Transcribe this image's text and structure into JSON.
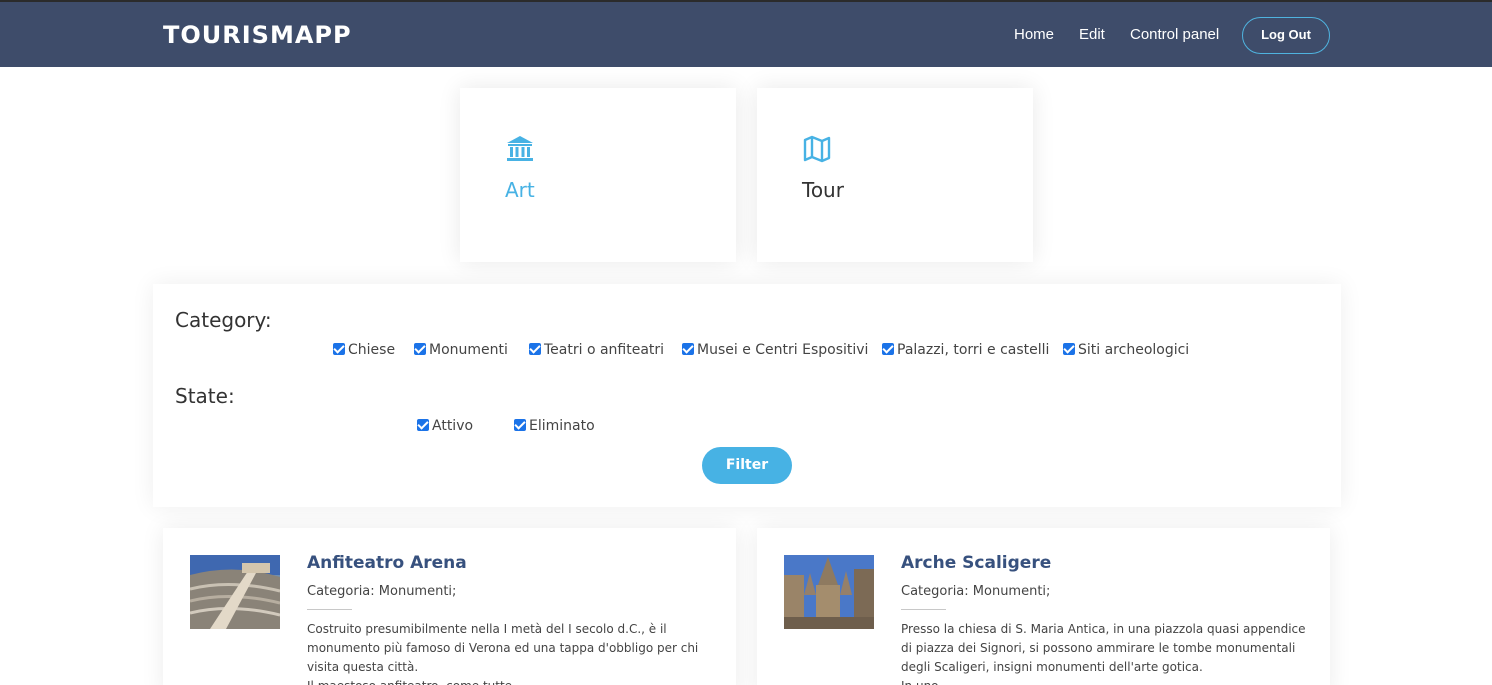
{
  "header": {
    "brand": "TOURISMAPP",
    "nav": [
      "Home",
      "Edit",
      "Control panel"
    ],
    "logout_label": "Log Out"
  },
  "tiles": [
    {
      "label": "Art",
      "icon": "museum-icon",
      "active": true
    },
    {
      "label": "Tour",
      "icon": "map-icon",
      "active": false
    }
  ],
  "filters": {
    "category_label": "Category:",
    "categories": [
      {
        "label": "Chiese",
        "checked": true
      },
      {
        "label": "Monumenti",
        "checked": true
      },
      {
        "label": "Teatri o anfiteatri",
        "checked": true
      },
      {
        "label": "Musei e Centri Espositivi",
        "checked": true
      },
      {
        "label": "Palazzi, torri e castelli",
        "checked": true
      },
      {
        "label": "Siti archeologici",
        "checked": true
      }
    ],
    "state_label": "State:",
    "states": [
      {
        "label": "Attivo",
        "checked": true
      },
      {
        "label": "Eliminato",
        "checked": true
      }
    ],
    "filter_button": "Filter"
  },
  "cards": [
    {
      "title": "Anfiteatro Arena",
      "category": "Categoria: Monumenti;",
      "description": [
        "Costruito presumibilmente nella I metà del I secolo d.C., è il",
        "monumento più famoso di Verona ed una tappa d'obbligo per chi",
        "visita questa città.",
        "Il maestoso anfiteatro, come tutte"
      ]
    },
    {
      "title": "Arche Scaligere",
      "category": "Categoria: Monumenti;",
      "description": [
        "Presso la chiesa di S. Maria Antica, in una piazzola quasi appendice",
        "di piazza dei Signori, si possono ammirare le tombe monumentali",
        "degli Scaligeri, insigni monumenti dell'arte gotica.",
        "In uno"
      ]
    }
  ],
  "colors": {
    "header_bg": "#3e4c6a",
    "accent": "#47b2e4",
    "title": "#37517e",
    "checkbox": "#1b73e8"
  }
}
